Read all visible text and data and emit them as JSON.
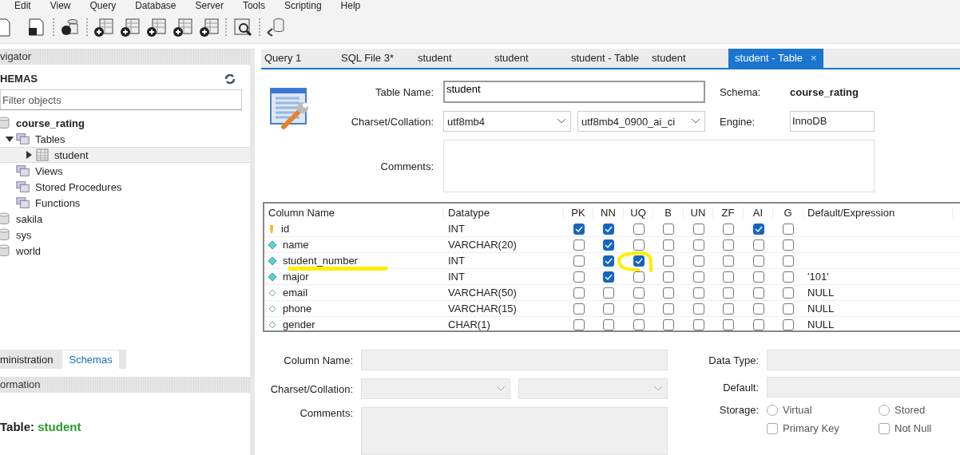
{
  "menu": [
    "Edit",
    "View",
    "Query",
    "Database",
    "Server",
    "Tools",
    "Scripting",
    "Help"
  ],
  "navigator": {
    "title": "vigator",
    "schemas_label": "HEMAS",
    "filter": {
      "placeholder": "Filter objects"
    },
    "tree": [
      {
        "label": "course_rating",
        "kind": "schema",
        "bold": true,
        "selected": false,
        "children": [
          {
            "label": "Tables",
            "kind": "folder",
            "expanded": true,
            "selected": false,
            "children": [
              {
                "label": "student",
                "kind": "table",
                "expanded": false,
                "selected": true
              }
            ]
          },
          {
            "label": "Views",
            "kind": "folder",
            "selected": false
          },
          {
            "label": "Stored Procedures",
            "kind": "folder",
            "selected": false
          },
          {
            "label": "Functions",
            "kind": "folder",
            "selected": false
          }
        ]
      },
      {
        "label": "sakila",
        "kind": "schema",
        "bold": false,
        "selected": false
      },
      {
        "label": "sys",
        "kind": "schema",
        "bold": false,
        "selected": false
      },
      {
        "label": "world",
        "kind": "schema",
        "bold": false,
        "selected": false
      }
    ]
  },
  "side_tabs": [
    {
      "label": "ministration",
      "selected": false
    },
    {
      "label": "Schemas",
      "selected": true
    }
  ],
  "information": {
    "title": "ormation",
    "label": "Table:",
    "value": "student"
  },
  "editor_tabs": [
    {
      "label": "Query 1",
      "selected": false
    },
    {
      "label": "SQL File 3*",
      "selected": false
    },
    {
      "label": "student",
      "selected": false
    },
    {
      "label": "student",
      "selected": false
    },
    {
      "label": "student - Table",
      "selected": false
    },
    {
      "label": "student",
      "selected": false
    },
    {
      "label": "student - Table",
      "selected": true,
      "close": "×"
    }
  ],
  "table_editor": {
    "table_name_label": "Table Name:",
    "table_name": "student",
    "schema_label": "Schema:",
    "schema": "course_rating",
    "charset_label": "Charset/Collation:",
    "charset": "utf8mb4",
    "collation": "utf8mb4_0900_ai_ci",
    "engine_label": "Engine:",
    "engine": "InnoDB",
    "comments_label": "Comments:"
  },
  "columns_grid": {
    "headers": [
      "Column Name",
      "Datatype",
      "PK",
      "NN",
      "UQ",
      "B",
      "UN",
      "ZF",
      "AI",
      "G",
      "Default/Expression"
    ],
    "rows": [
      {
        "name": "id",
        "kind": "key",
        "datatype": "INT",
        "flags": [
          true,
          true,
          false,
          false,
          false,
          false,
          true,
          false
        ]
      },
      {
        "name": "name",
        "kind": "not_null",
        "datatype": "VARCHAR(20)",
        "flags": [
          false,
          true,
          false,
          false,
          false,
          false,
          false,
          false
        ]
      },
      {
        "name": "student_number",
        "kind": "not_null",
        "datatype": "INT",
        "flags": [
          false,
          true,
          true,
          false,
          false,
          false,
          false,
          false
        ]
      },
      {
        "name": "major",
        "kind": "not_null",
        "datatype": "INT",
        "flags": [
          false,
          true,
          false,
          false,
          false,
          false,
          false,
          false
        ],
        "default": "'101'"
      },
      {
        "name": "email",
        "kind": "nullable",
        "datatype": "VARCHAR(50)",
        "flags": [
          false,
          false,
          false,
          false,
          false,
          false,
          false,
          false
        ],
        "default": "NULL"
      },
      {
        "name": "phone",
        "kind": "nullable",
        "datatype": "VARCHAR(15)",
        "flags": [
          false,
          false,
          false,
          false,
          false,
          false,
          false,
          false
        ],
        "default": "NULL"
      },
      {
        "name": "gender",
        "kind": "nullable",
        "datatype": "CHAR(1)",
        "flags": [
          false,
          false,
          false,
          false,
          false,
          false,
          false,
          false
        ],
        "default": "NULL"
      }
    ]
  },
  "column_details": {
    "column_name_label": "Column Name:",
    "charset_label": "Charset/Collation:",
    "comments_label": "Comments:",
    "data_type_label": "Data Type:",
    "default_label": "Default:",
    "storage_label": "Storage:",
    "storage_options": [
      {
        "label": "Virtual",
        "selected": false
      },
      {
        "label": "Stored",
        "selected": false
      }
    ],
    "options": [
      {
        "label": "Primary Key",
        "checked": false
      },
      {
        "label": "Not Null",
        "checked": false
      }
    ]
  }
}
